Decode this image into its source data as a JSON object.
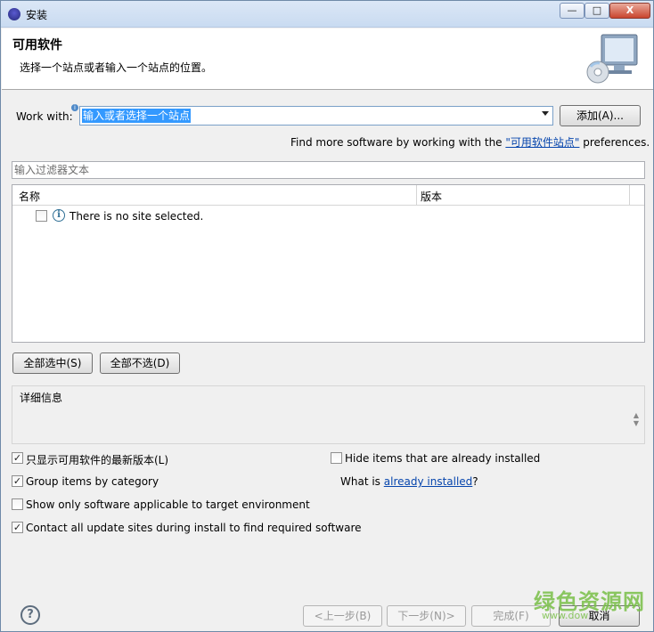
{
  "window": {
    "title": "安装",
    "min_label": "—",
    "max_label": "□",
    "close_label": "X"
  },
  "header": {
    "title": "可用软件",
    "subtitle": "选择一个站点或者输入一个站点的位置。"
  },
  "work_with": {
    "label": "Work with:",
    "value": "输入或者选择一个站点",
    "add_button": "添加(A)..."
  },
  "find_more": {
    "prefix": "Find more software by working with the ",
    "link": "\"可用软件站点\"",
    "suffix": " preferences."
  },
  "filter": {
    "placeholder": "输入过滤器文本"
  },
  "table": {
    "columns": [
      "名称",
      "版本"
    ],
    "rows": [
      {
        "text": "There is no site selected.",
        "checked": false
      }
    ]
  },
  "buttons": {
    "select_all": "全部选中(S)",
    "deselect_all": "全部不选(D)"
  },
  "details": {
    "label": "详细信息"
  },
  "options": {
    "show_latest": {
      "label": "只显示可用软件的最新版本(L)",
      "checked": true
    },
    "hide_installed": {
      "label": "Hide items that are already installed",
      "checked": false
    },
    "group_by_category": {
      "label": "Group items by category",
      "checked": true
    },
    "what_is": {
      "prefix": "What is ",
      "link": "already installed",
      "suffix": "?"
    },
    "show_applicable": {
      "label": "Show only software applicable to target environment",
      "checked": false
    },
    "contact_sites": {
      "label": "Contact all update sites during install to find required software",
      "checked": true
    }
  },
  "footer": {
    "help": "?",
    "back": "<上一步(B)",
    "next": "下一步(N)>",
    "finish": "完成(F)",
    "cancel": "取消"
  },
  "watermark": {
    "text": "绿色资源网",
    "url": "www.dow"
  }
}
